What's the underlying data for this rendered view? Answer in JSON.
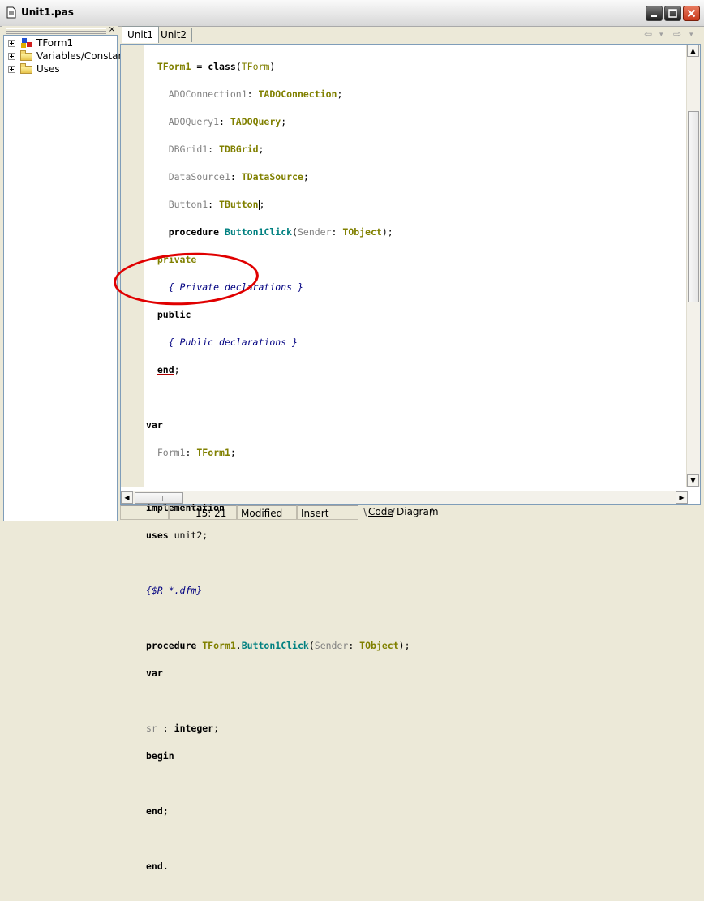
{
  "window": {
    "title": "Unit1.pas"
  },
  "structure_pane": {
    "close_label": "×",
    "items": [
      {
        "label": "TForm1"
      },
      {
        "label": "Variables/Constants"
      },
      {
        "label": "Uses"
      }
    ]
  },
  "tabs": [
    {
      "label": "Unit1",
      "active": true
    },
    {
      "label": "Unit2",
      "active": false
    }
  ],
  "nav": {
    "back": "⇦",
    "back_drop": "▾",
    "forward": "⇨",
    "forward_drop": "▾"
  },
  "code": {
    "l01": {
      "a": "TForm1",
      "b": " = ",
      "c": "class",
      "d": "(",
      "e": "TForm",
      "f": ")"
    },
    "l02": {
      "a": "ADOConnection1",
      "b": ": ",
      "c": "TADOConnection",
      "d": ";"
    },
    "l03": {
      "a": "ADOQuery1",
      "b": ": ",
      "c": "TADOQuery",
      "d": ";"
    },
    "l04": {
      "a": "DBGrid1",
      "b": ": ",
      "c": "TDBGrid",
      "d": ";"
    },
    "l05": {
      "a": "DataSource1",
      "b": ": ",
      "c": "TDataSource",
      "d": ";"
    },
    "l06": {
      "a": "Button1",
      "b": ": ",
      "c": "TButton",
      "d": ";"
    },
    "l07": {
      "a": "procedure",
      "b": " ",
      "c": "Button1Click",
      "d": "(",
      "e": "Sender",
      "f": ": ",
      "g": "TObject",
      "h": ");"
    },
    "l08": "private",
    "l09": "{ Private declarations }",
    "l10": "public",
    "l11": "{ Public declarations }",
    "l12": {
      "a": "end",
      "b": ";"
    },
    "l14": "var",
    "l15": {
      "a": "Form1",
      "b": ": ",
      "c": "TForm1",
      "d": ";"
    },
    "l17": "implementation",
    "l18": {
      "a": "uses",
      "b": " unit2;"
    },
    "l20": "{$R *.dfm}",
    "l22": {
      "a": "procedure",
      "b": " ",
      "c": "TForm1",
      "d": ".",
      "e": "Button1Click",
      "f": "(",
      "g": "Sender",
      "h": ": ",
      "i": "TObject",
      "j": ");"
    },
    "l23": "var",
    "l25": {
      "a": "sr",
      "b": " : ",
      "c": "integer",
      "d": ";"
    },
    "l26": "begin",
    "l28": "end;",
    "l30": "end."
  },
  "scroll": {
    "up": "▲",
    "down": "▼",
    "left": "◀",
    "right": "▶"
  },
  "status": {
    "position": "15:  21",
    "modified": "Modified",
    "mode": "Insert"
  },
  "view_tabs": {
    "code": "Code",
    "diagram": "Diagram"
  },
  "colors": {
    "annotation": "#e00000",
    "keyword_underline": "#b00000",
    "type": "#808000",
    "method": "#008080",
    "comment": "#000080"
  }
}
